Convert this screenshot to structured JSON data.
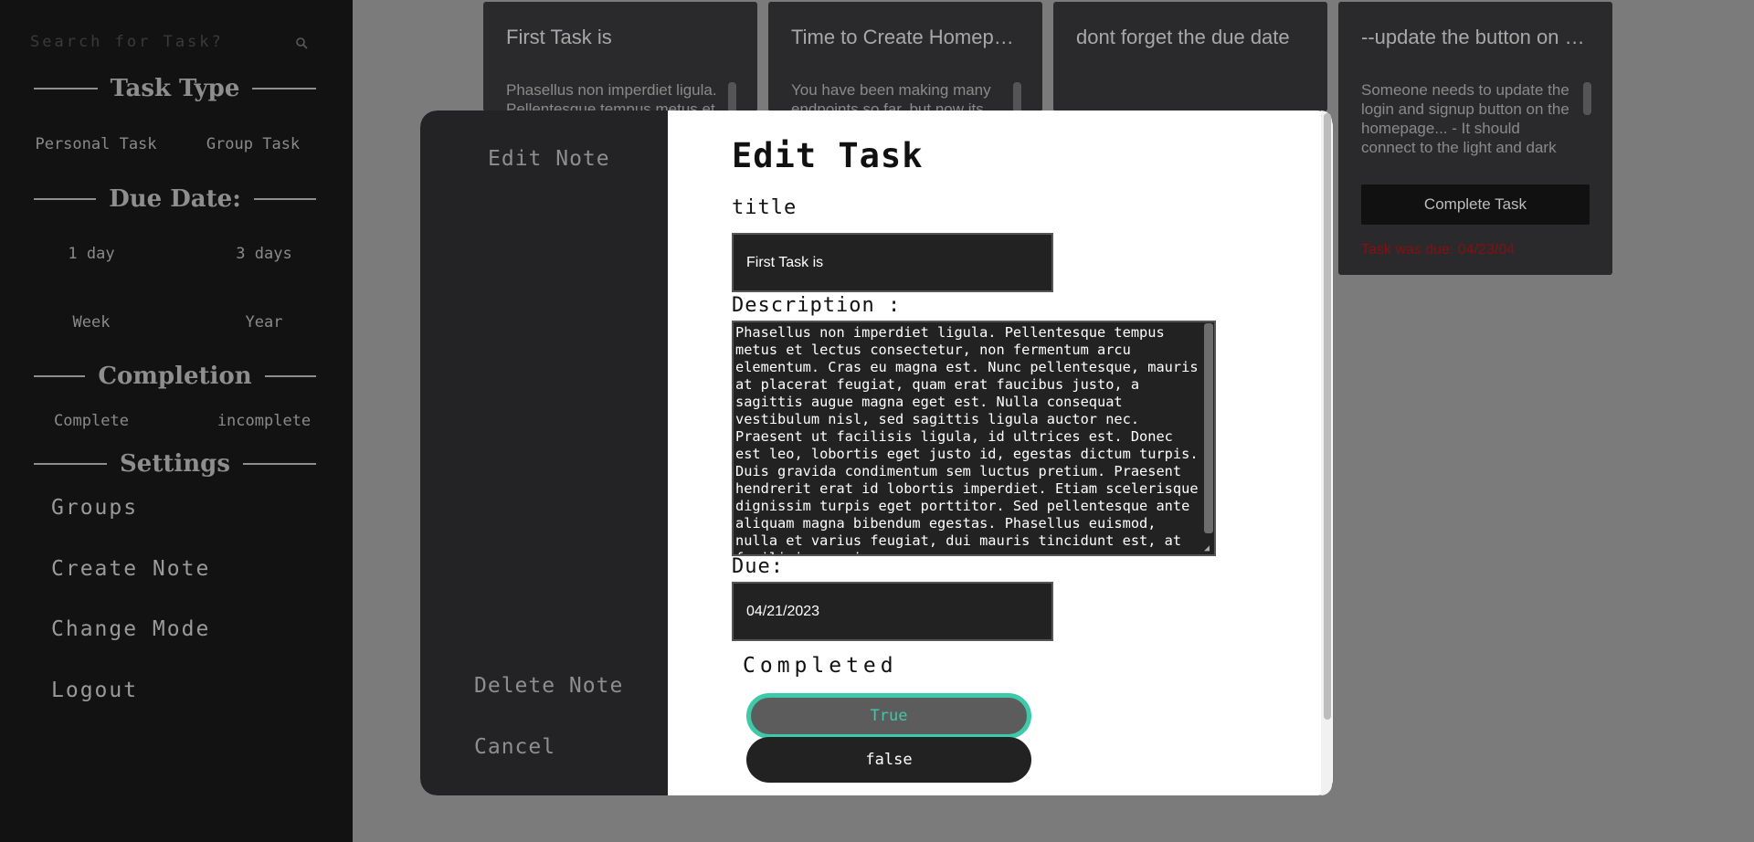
{
  "sidebar": {
    "search_placeholder": "Search for Task?",
    "task_type_heading": "Task Type",
    "personal_task": "Personal Task",
    "group_task": "Group Task",
    "due_date_heading": "Due Date:",
    "due_1day": "1 day",
    "due_3days": "3 days",
    "due_week": "Week",
    "due_year": "Year",
    "completion_heading": "Completion",
    "complete": "Complete",
    "incomplete": "incomplete",
    "settings_heading": "Settings",
    "groups": "Groups",
    "create_note": "Create Note",
    "change_mode": "Change Mode",
    "logout": "Logout"
  },
  "cards": [
    {
      "title": "First Task is",
      "desc": "Phasellus non imperdiet ligula. Pellentesque tempus metus et"
    },
    {
      "title": "Time to Create Homepage",
      "desc": "You have been making many endpoints so far, but now its"
    },
    {
      "title": "dont forget the due date",
      "desc": ""
    },
    {
      "title": "--update the button on the homepage",
      "desc": "Someone needs to update the login and signup button on the homepage... - It should connect to the light and dark mode. The user is logged-I'll",
      "button": "Complete Task",
      "due_text": "Task was due: 04/23/04"
    }
  ],
  "modal": {
    "side_edit": "Edit Note",
    "side_delete": "Delete Note",
    "side_cancel": "Cancel",
    "title": "Edit Task",
    "title_label": "title",
    "title_value": "First Task is",
    "description_label": "Description :",
    "description_value": "Phasellus non imperdiet ligula. Pellentesque tempus metus et lectus consectetur, non fermentum arcu elementum. Cras eu magna est. Nunc pellentesque, mauris at placerat feugiat, quam erat faucibus justo, a sagittis augue magna eget est. Nulla consequat vestibulum nisl, sed sagittis ligula auctor nec. Praesent ut facilisis ligula, id ultrices est. Donec est leo, lobortis eget justo id, egestas dictum turpis. Duis gravida condimentum sem luctus pretium. Praesent hendrerit erat id lobortis imperdiet. Etiam scelerisque dignissim turpis eget porttitor. Sed pellentesque ante aliquam magna bibendum egestas. Phasellus euismod, nulla et varius feugiat, dui mauris tincidunt est, at facilisis mauris",
    "due_label": "Due:",
    "due_value": "04/21/2023",
    "completed_label": "Completed",
    "true_label": "True",
    "false_label": "false"
  },
  "colors": {
    "accent": "#3ccaa8",
    "overdue": "#8a0e0e"
  }
}
